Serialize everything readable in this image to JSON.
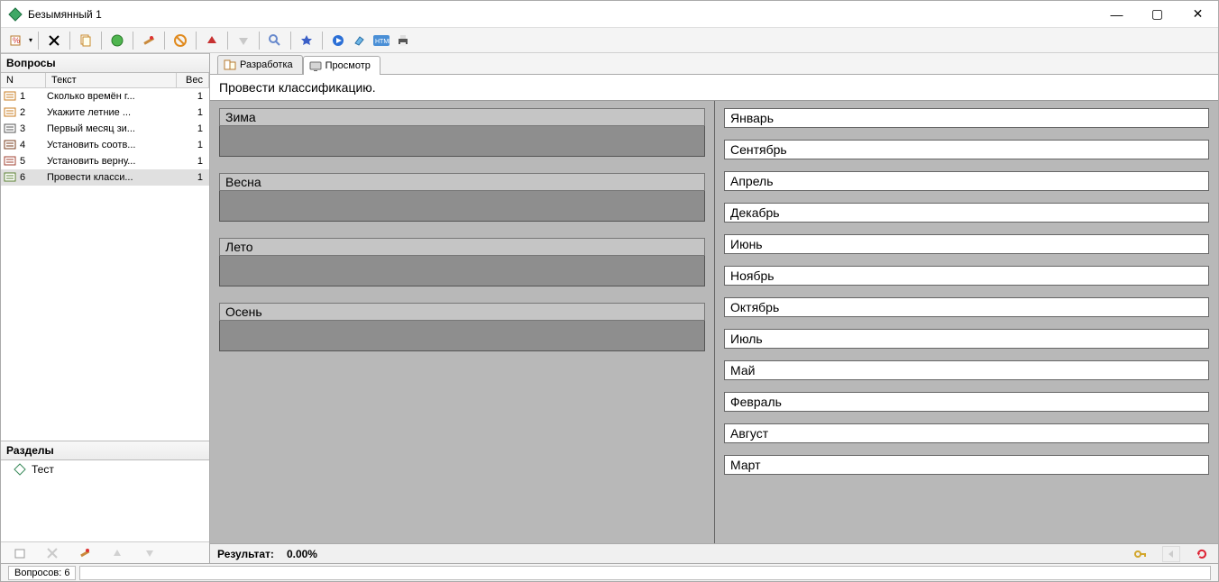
{
  "title": "Безымянный 1",
  "win_controls": {
    "min": "—",
    "max": "▢",
    "close": "✕"
  },
  "panes": {
    "questions_header": "Вопросы",
    "sections_header": "Разделы"
  },
  "columns": {
    "n": "N",
    "text": "Текст",
    "weight": "Вес"
  },
  "questions": [
    {
      "n": "1",
      "text": "Сколько времён г...",
      "weight": "1",
      "icon": "a"
    },
    {
      "n": "2",
      "text": "Укажите летние ...",
      "weight": "1",
      "icon": "a"
    },
    {
      "n": "3",
      "text": "Первый месяц зи...",
      "weight": "1",
      "icon": "b"
    },
    {
      "n": "4",
      "text": "Установить соотв...",
      "weight": "1",
      "icon": "c"
    },
    {
      "n": "5",
      "text": "Установить верну...",
      "weight": "1",
      "icon": "d"
    },
    {
      "n": "6",
      "text": "Провести класси...",
      "weight": "1",
      "icon": "e",
      "selected": true
    }
  ],
  "sections": [
    {
      "name": "Тест",
      "icon": "diamond"
    }
  ],
  "tabs": {
    "develop": "Разработка",
    "view": "Просмотр"
  },
  "question_text": "Провести классификацию.",
  "categories": [
    {
      "label": "Зима"
    },
    {
      "label": "Весна"
    },
    {
      "label": "Лето"
    },
    {
      "label": "Осень"
    }
  ],
  "items": [
    "Январь",
    "Сентябрь",
    "Апрель",
    "Декабрь",
    "Июнь",
    "Ноябрь",
    "Октябрь",
    "Июль",
    "Май",
    "Февраль",
    "Август",
    "Март"
  ],
  "result": {
    "label": "Результат:",
    "value": "0.00%"
  },
  "status": {
    "count": "Вопросов: 6"
  }
}
